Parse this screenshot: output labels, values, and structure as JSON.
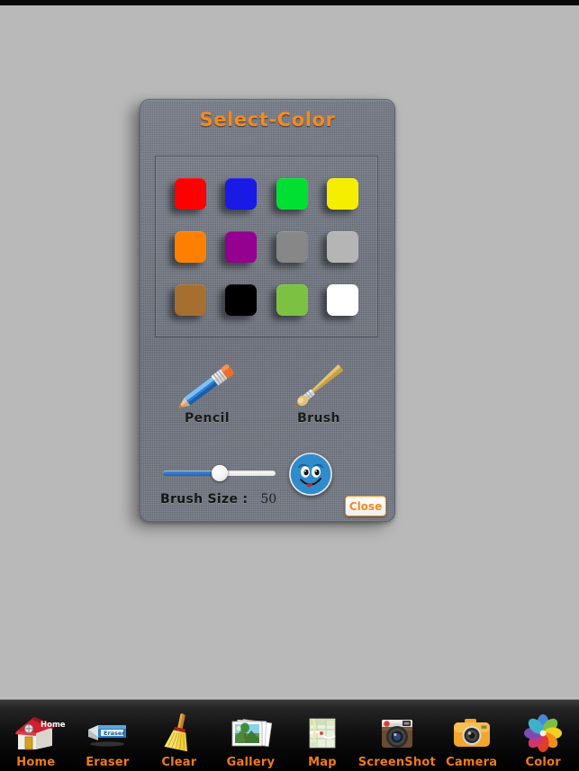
{
  "app": {
    "canvas_bg": "#b9b9b9",
    "accent": "#f68a1e"
  },
  "dialog": {
    "title": "Select-Color",
    "swatch_rows": [
      [
        {
          "name": "red",
          "hex": "#FF0000"
        },
        {
          "name": "blue",
          "hex": "#1A1AE6"
        },
        {
          "name": "green",
          "hex": "#00E033"
        },
        {
          "name": "yellow",
          "hex": "#F5EE00"
        }
      ],
      [
        {
          "name": "orange",
          "hex": "#FF8000"
        },
        {
          "name": "purple",
          "hex": "#94008F"
        },
        {
          "name": "gray",
          "hex": "#878787"
        },
        {
          "name": "light-gray",
          "hex": "#B5B5B5"
        }
      ],
      [
        {
          "name": "brown",
          "hex": "#A5702F"
        },
        {
          "name": "black",
          "hex": "#000000"
        },
        {
          "name": "lime",
          "hex": "#7CC142"
        },
        {
          "name": "white",
          "hex": "#FFFFFF"
        }
      ]
    ],
    "tools": [
      {
        "name": "pencil",
        "label": "Pencil"
      },
      {
        "name": "brush",
        "label": "Brush"
      }
    ],
    "brush_size": {
      "label": "Brush Size :",
      "value": "50",
      "slider_percent": 50
    },
    "preview": {
      "name": "smiley-face",
      "color": "#2e8ccd"
    },
    "close": {
      "label": "Close"
    }
  },
  "toolbar": {
    "items": [
      {
        "label": "Home",
        "icon": "home-icon"
      },
      {
        "label": "Eraser",
        "icon": "eraser-icon"
      },
      {
        "label": "Clear",
        "icon": "broom-icon"
      },
      {
        "label": "Gallery",
        "icon": "photos-icon"
      },
      {
        "label": "Map",
        "icon": "map-icon"
      },
      {
        "label": "ScreenShot",
        "icon": "retro-camera-icon"
      },
      {
        "label": "Camera",
        "icon": "camera-icon"
      },
      {
        "label": "Color",
        "icon": "color-wheel-icon"
      }
    ]
  }
}
